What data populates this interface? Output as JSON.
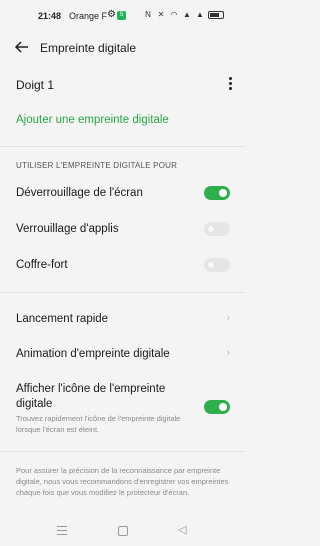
{
  "status_bar": {
    "time": "21:48",
    "carrier": "Orange F",
    "app_badge": "S"
  },
  "header": {
    "title": "Empreinte digitale"
  },
  "fingerprint": {
    "name": "Doigt 1"
  },
  "add_fingerprint_label": "Ajouter une empreinte digitale",
  "section_title": "UTILISER L'EMPREINTE DIGITALE POUR",
  "settings": [
    {
      "label": "Déverrouillage de l'écran",
      "enabled": true
    },
    {
      "label": "Verrouillage d'applis",
      "enabled": false
    },
    {
      "label": "Coffre-fort",
      "enabled": false
    }
  ],
  "links": [
    {
      "label": "Lancement rapide"
    },
    {
      "label": "Animation d'empreinte digitale"
    }
  ],
  "show_icon": {
    "label_line1": "Afficher l'icône de l'empreinte",
    "label_line2": "digitale",
    "description": "Trouvez rapidement l'icône de l'empreinte digitale lorsque l'écran est éteint.",
    "enabled": true
  },
  "footer_note": "Pour assurer la précision de la reconnaissance par empreinte digitale, nous vous recommandons d'enregistrer vos empreintes chaque fois que vous modifiez le protecteur d'écran.",
  "colors": {
    "accent": "#2fae4e",
    "link": "#2aa547",
    "background": "#f4f4f4"
  }
}
